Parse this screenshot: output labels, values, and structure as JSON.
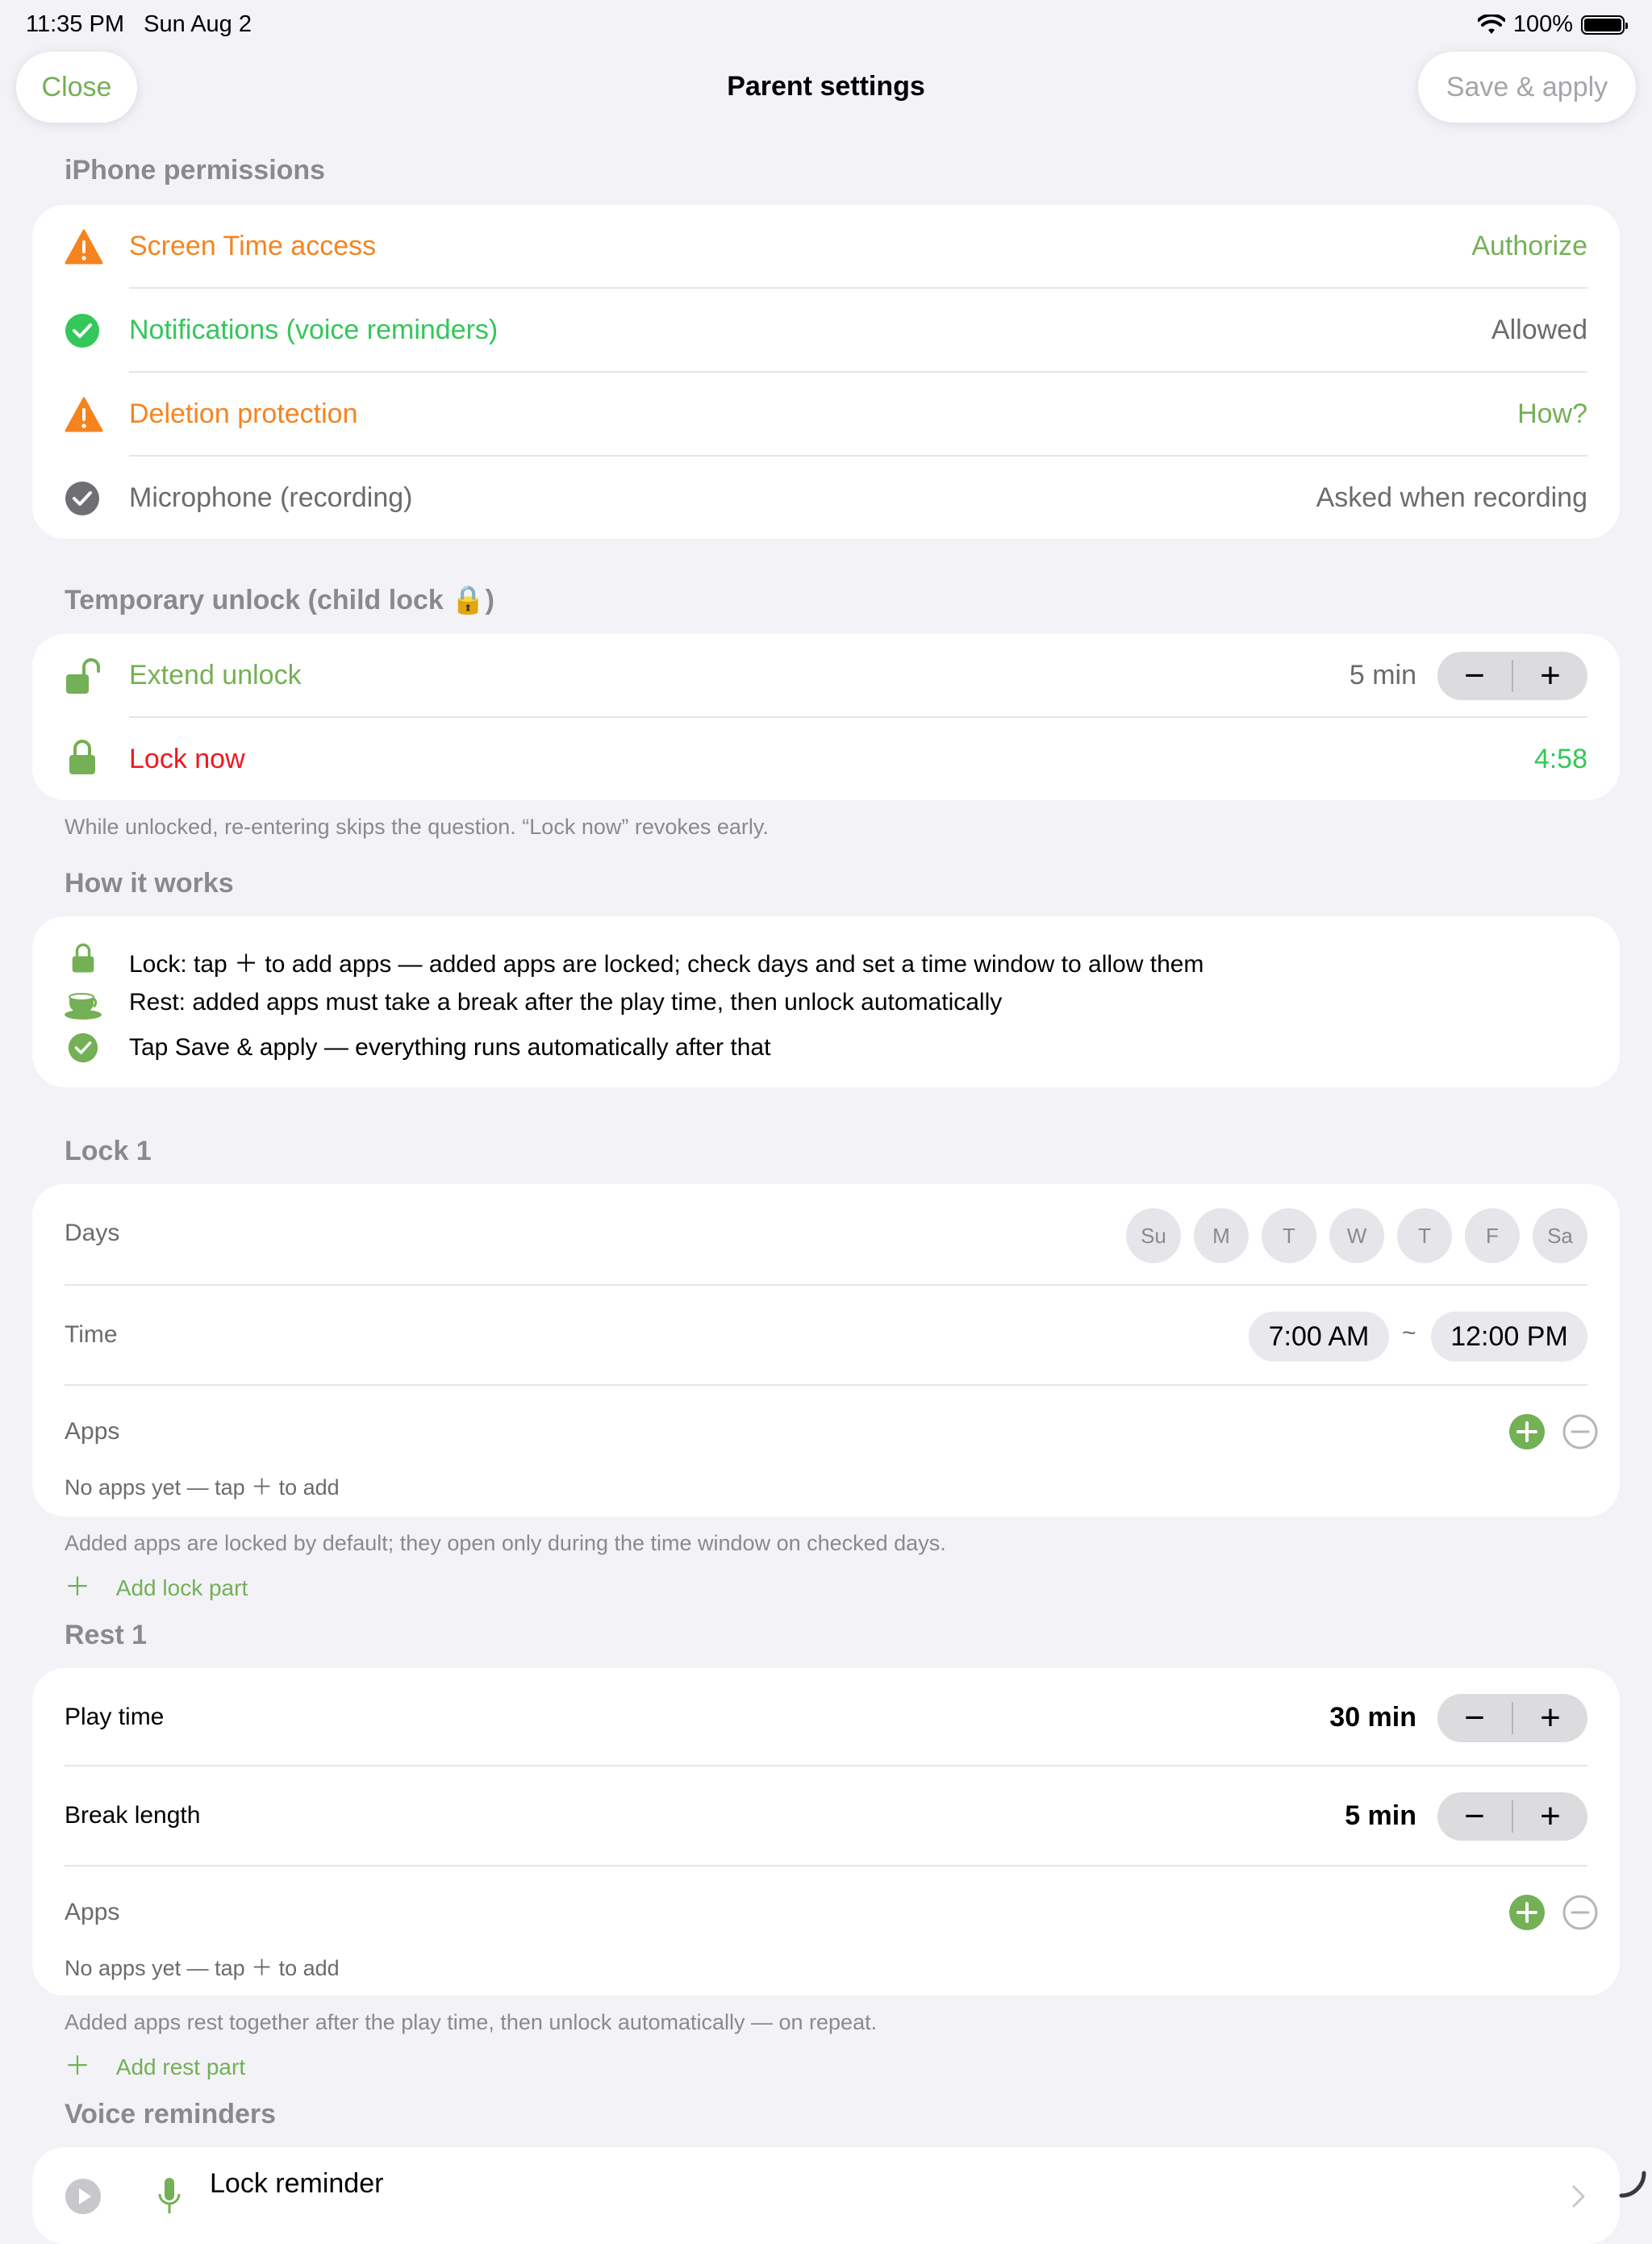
{
  "status_bar": {
    "time": "11:35 PM",
    "date": "Sun Aug 2",
    "battery": "100%"
  },
  "nav": {
    "close": "Close",
    "title": "Parent settings",
    "save": "Save & apply"
  },
  "permissions": {
    "header": "iPhone permissions",
    "rows": [
      {
        "label": "Screen Time access",
        "value": "Authorize"
      },
      {
        "label": "Notifications (voice reminders)",
        "value": "Allowed"
      },
      {
        "label": "Deletion protection",
        "value": "How?"
      },
      {
        "label": "Microphone (recording)",
        "value": "Asked when recording"
      }
    ]
  },
  "temp_unlock": {
    "header": "Temporary unlock (child lock 🔒)",
    "extend_label": "Extend unlock",
    "extend_value": "5 min",
    "lock_label": "Lock now",
    "lock_timer": "4:58",
    "footnote": "While unlocked, re-entering skips the question. “Lock now” revokes early.",
    "minus": "−",
    "plus": "+"
  },
  "how": {
    "header": "How it works",
    "lines": [
      "Lock: tap ＋ to add apps — added apps are locked; check days and set a time window to allow them",
      "Rest: added apps must take a break after the play time, then unlock automatically",
      "Tap Save & apply — everything runs automatically after that"
    ]
  },
  "lock1": {
    "header": "Lock 1",
    "days_label": "Days",
    "days": [
      "Su",
      "M",
      "T",
      "W",
      "T",
      "F",
      "Sa"
    ],
    "time_label": "Time",
    "start": "7:00 AM",
    "tilde": "~",
    "end": "12:00 PM",
    "apps_label": "Apps",
    "apps_empty": "No apps yet — tap ＋ to add",
    "footnote": "Added apps are locked by default; they open only during the time window on checked days.",
    "add_part": "Add lock part"
  },
  "rest1": {
    "header": "Rest 1",
    "play_label": "Play time",
    "play_value": "30 min",
    "break_label": "Break length",
    "break_value": "5 min",
    "apps_label": "Apps",
    "apps_empty": "No apps yet — tap ＋ to add",
    "footnote": "Added apps rest together after the play time, then unlock automatically — on repeat.",
    "add_part": "Add rest part"
  },
  "voice": {
    "header": "Voice reminders",
    "first_row": "Lock reminder"
  },
  "colors": {
    "accent_green": "#74b055",
    "warning_orange": "#f5841f",
    "success_green": "#34c759",
    "destructive_red": "#f2161f",
    "background": "#f2f2f7"
  },
  "icons": {
    "warning": "warning-triangle-icon",
    "check": "check-circle-icon",
    "unlock": "unlock-icon",
    "lock": "lock-icon",
    "cup": "teacup-icon",
    "add": "plus-circle-icon",
    "remove": "minus-circle-icon",
    "play": "play-icon",
    "mic": "microphone-icon",
    "chevron": "chevron-right-icon"
  }
}
